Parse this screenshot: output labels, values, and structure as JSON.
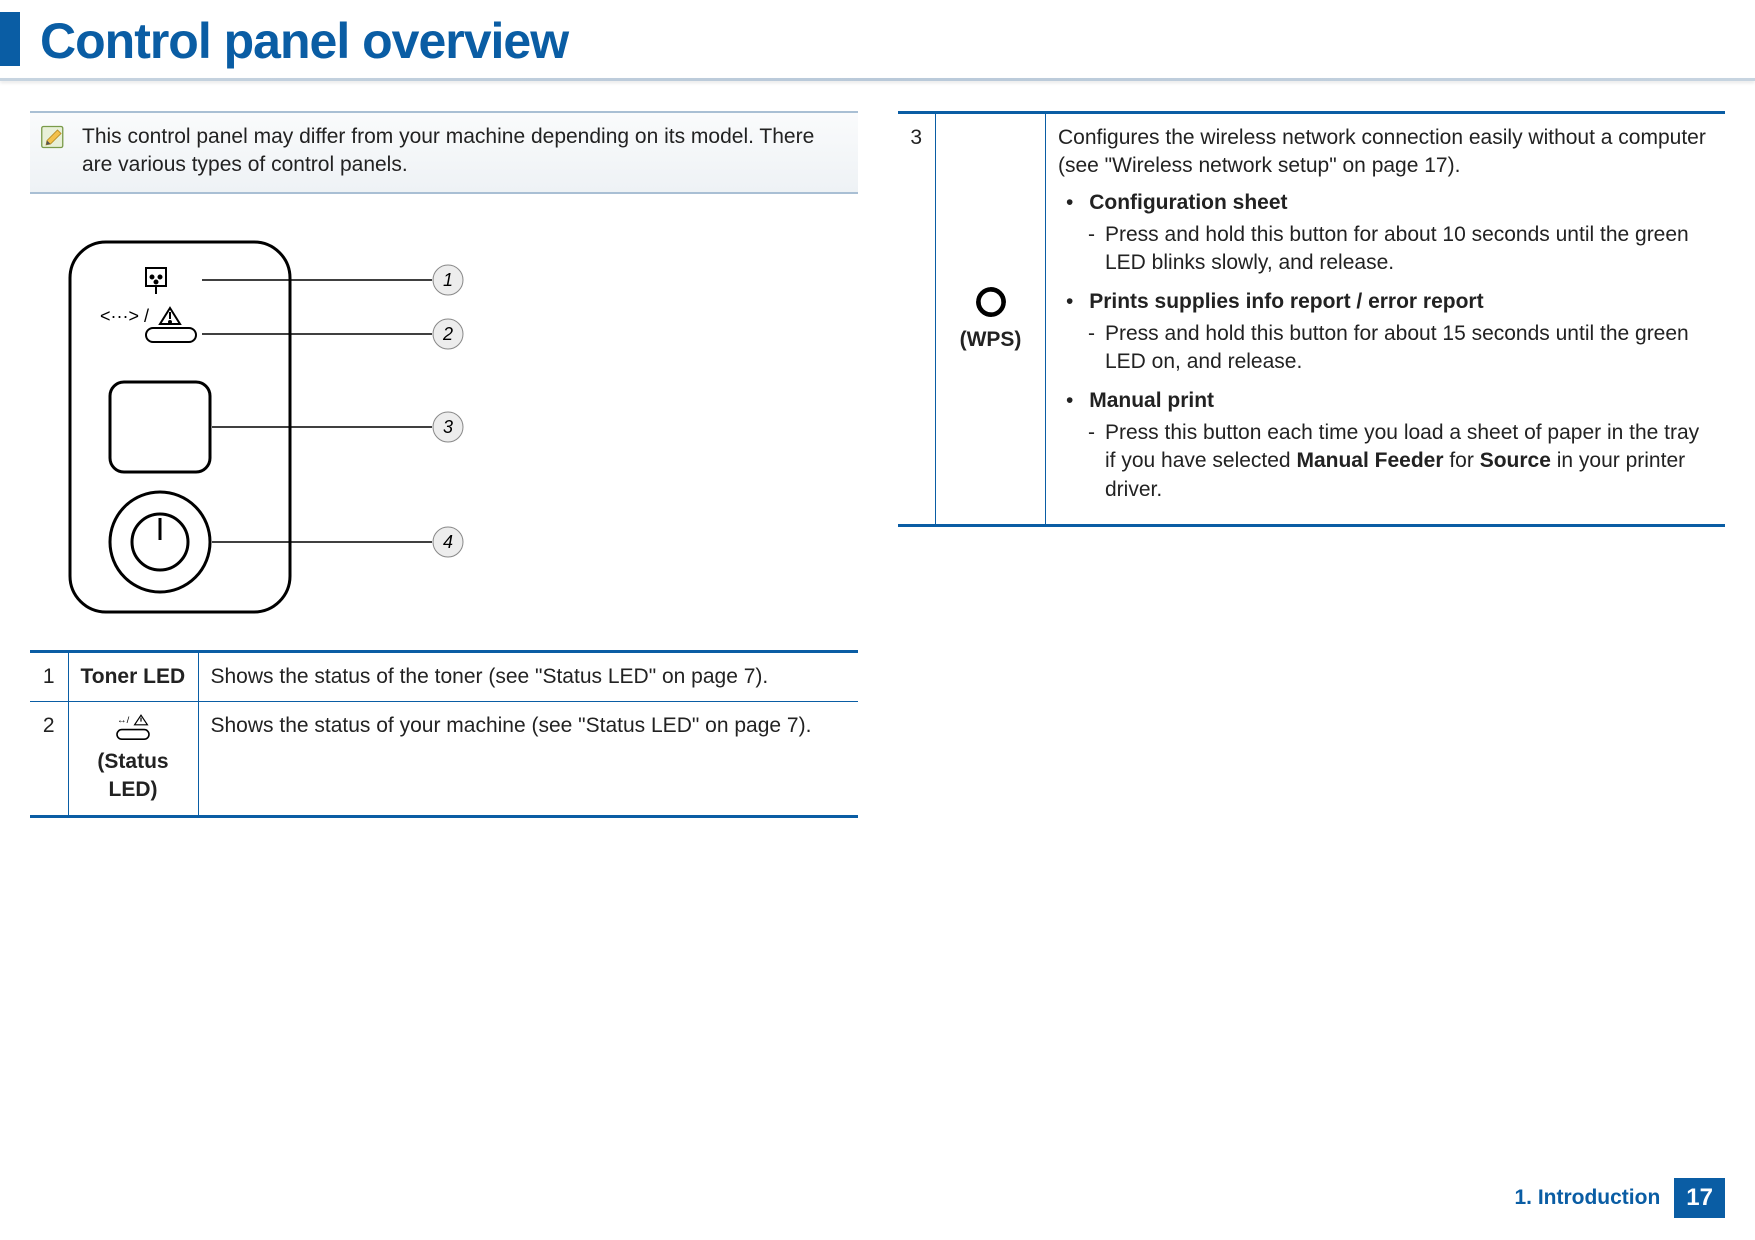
{
  "header": {
    "title": "Control panel overview"
  },
  "note": {
    "text": "This control panel may differ from your machine depending on its model. There are various types of control panels."
  },
  "diagram": {
    "callouts": [
      "1",
      "2",
      "3",
      "4"
    ]
  },
  "left_table": {
    "rows": [
      {
        "num": "1",
        "label": "Toner LED",
        "desc": "Shows the status of the toner (see \"Status LED\" on page 7)."
      },
      {
        "num": "2",
        "label": "(Status LED)",
        "desc": "Shows the status of your machine (see \"Status LED\" on page 7)."
      }
    ]
  },
  "right_table": {
    "row": {
      "num": "3",
      "label": "(WPS)",
      "intro": "Configures the wireless network connection easily without a computer (see \"Wireless network setup\" on page 17).",
      "items": [
        {
          "title": "Configuration sheet",
          "sub": "Press and hold this button for about 10 seconds until the green LED blinks slowly, and release."
        },
        {
          "title": "Prints supplies info report / error report",
          "sub": "Press and hold this button for about 15 seconds until the green LED on, and release."
        },
        {
          "title": "Manual print",
          "sub_html": "Press this button each time you load a sheet of paper in the tray if you have selected <b>Manual Feeder</b> for <b>Source</b> in your printer driver."
        }
      ]
    }
  },
  "footer": {
    "chapter": "1. Introduction",
    "page": "17"
  }
}
